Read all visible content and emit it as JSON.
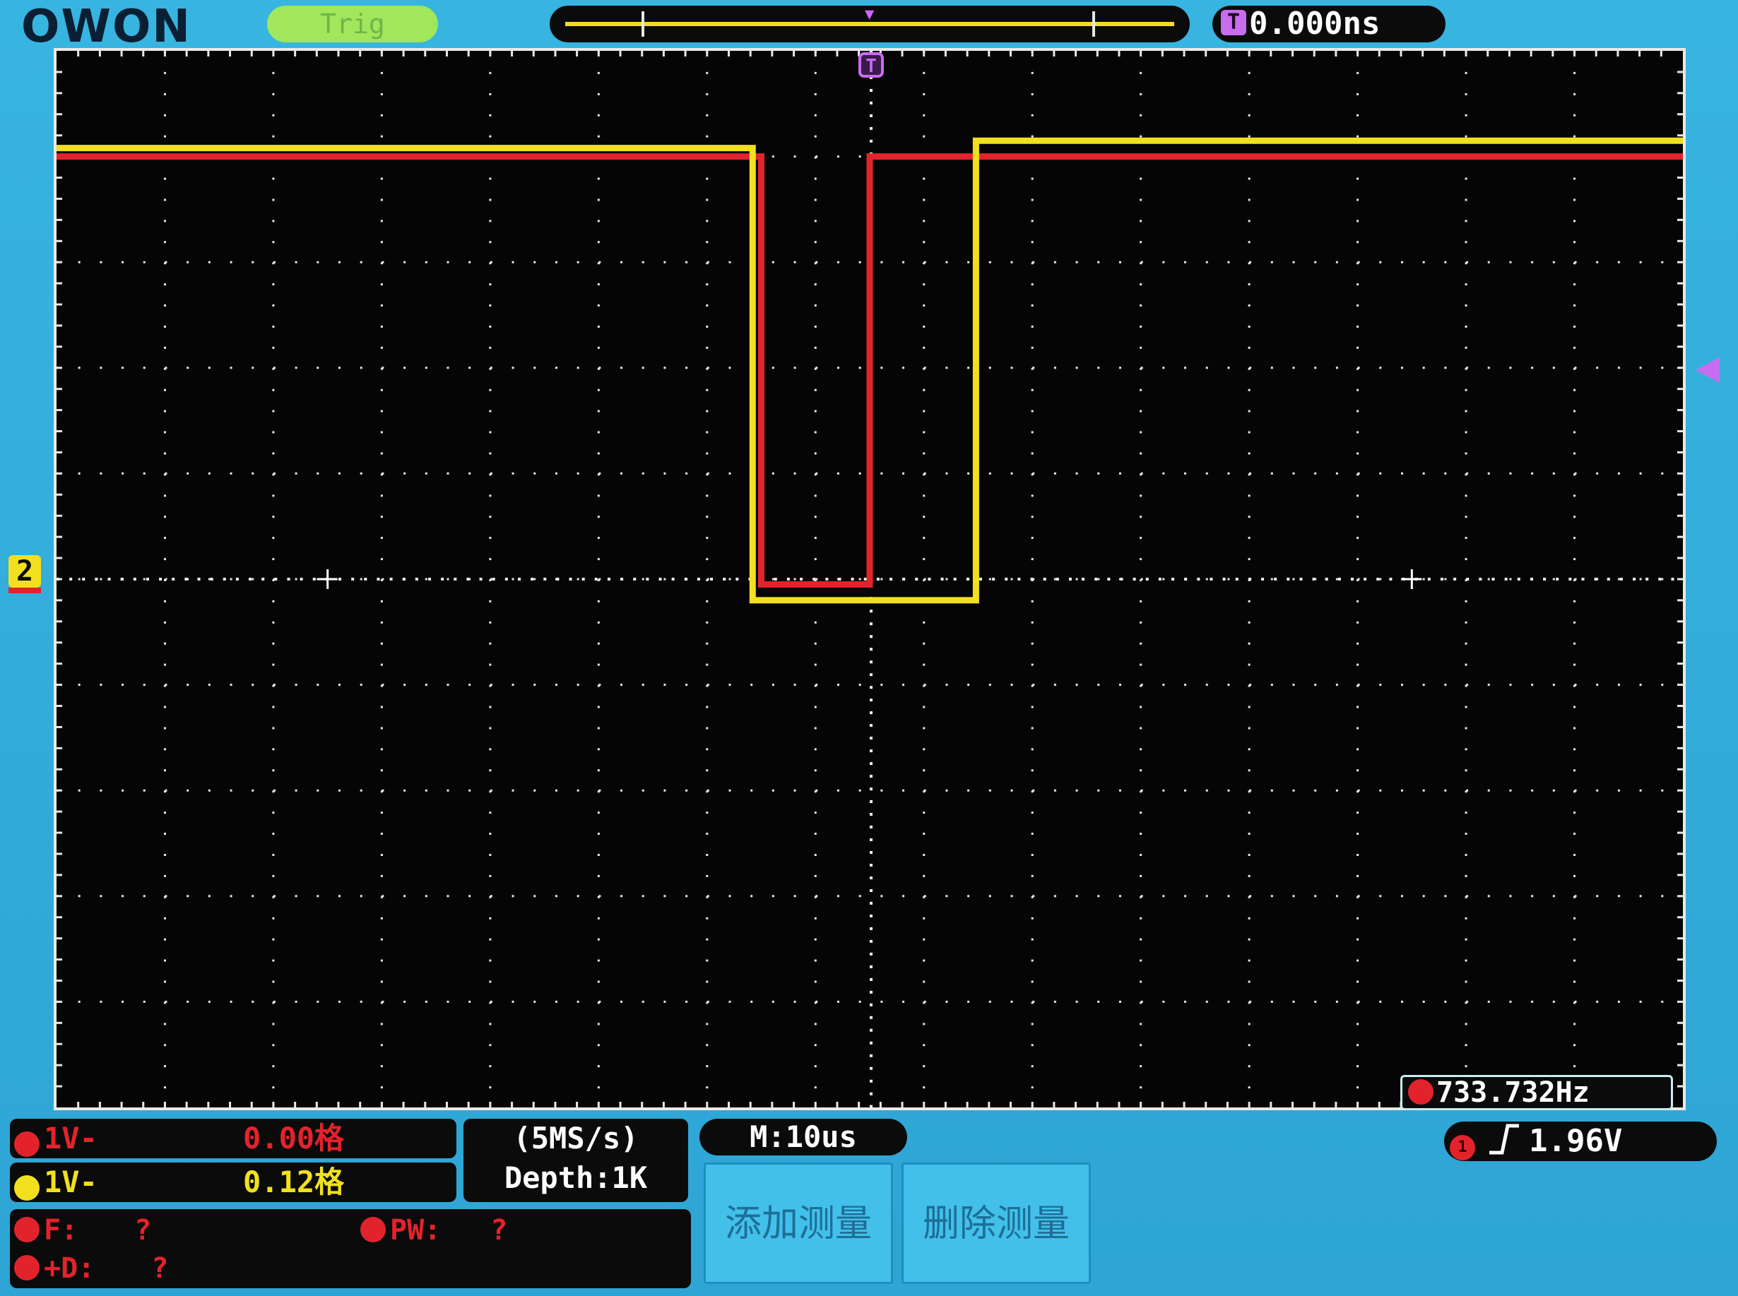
{
  "header": {
    "logo": "OWON",
    "trigger_status": "Trig",
    "trigger_delay": "0.000ns",
    "trigger_badge": "T"
  },
  "screen": {
    "ch2_marker": "2",
    "grid": {
      "divisions_x": 15,
      "divisions_y": 10
    },
    "frequency_readout": "733.732Hz"
  },
  "channels": [
    {
      "id": "1",
      "scale": "1V-",
      "offset": "0.00格",
      "color": "#e3232c"
    },
    {
      "id": "2",
      "scale": "1V-",
      "offset": "0.12格",
      "color": "#f2e01e"
    }
  ],
  "acquisition": {
    "sample_rate": "(5MS/s)",
    "depth": "Depth:1K"
  },
  "timebase": "M:10us",
  "trigger": {
    "source": "1",
    "edge": "rising",
    "level": "1.96V"
  },
  "measurements": [
    {
      "label": "F:",
      "value": "?"
    },
    {
      "label": "PW:",
      "value": "?"
    },
    {
      "label": "+D:",
      "value": "?"
    }
  ],
  "soft_buttons": {
    "add": "添加测量",
    "delete": "删除测量"
  },
  "colors": {
    "ch1": "#e3232c",
    "ch2": "#f2e01e",
    "trigger": "#c86cf0",
    "frame": "#2ea8d6"
  },
  "chart_data": {
    "type": "line",
    "time_per_div_us": 10,
    "volts_per_div": 1,
    "x_range_div": [
      -7.5,
      7.5
    ],
    "y_range_div": [
      -5,
      5
    ],
    "series": [
      {
        "name": "CH1",
        "color": "#e3232c",
        "points_div": [
          [
            -7.5,
            4.0
          ],
          [
            -0.05,
            4.0
          ],
          [
            -0.05,
            4.1
          ],
          [
            0.0,
            4.1
          ],
          [
            0.0,
            -0.05
          ],
          [
            -1.0,
            -0.05
          ],
          [
            -1.0,
            4.0
          ],
          [
            -0.05,
            4.0
          ]
        ],
        "note_ch1_low_start_div": -1.0,
        "note_ch1_low_end_div": 0.0
      },
      {
        "name": "CH2",
        "color": "#f2e01e",
        "points_div": [
          [
            -7.5,
            4.08
          ],
          [
            -1.08,
            4.08
          ],
          [
            -1.08,
            -0.2
          ],
          [
            0.98,
            -0.2
          ],
          [
            0.98,
            4.15
          ],
          [
            7.5,
            4.15
          ]
        ]
      }
    ]
  }
}
